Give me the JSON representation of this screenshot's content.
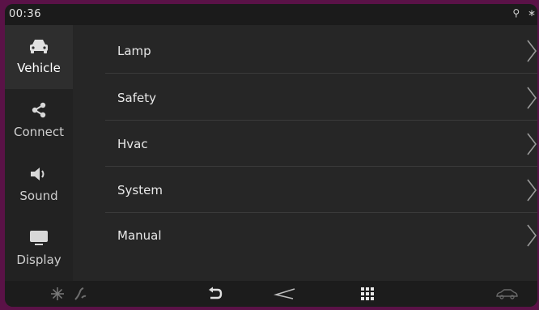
{
  "status": {
    "time": "00:36",
    "icons": [
      "usb-icon",
      "bluetooth-icon"
    ]
  },
  "sidebar": {
    "items": [
      {
        "label": "Vehicle",
        "icon": "car-icon",
        "active": true
      },
      {
        "label": "Connect",
        "icon": "share-icon",
        "active": false
      },
      {
        "label": "Sound",
        "icon": "speaker-icon",
        "active": false
      },
      {
        "label": "Display",
        "icon": "monitor-icon",
        "active": false
      }
    ]
  },
  "menu": {
    "items": [
      {
        "label": "Lamp"
      },
      {
        "label": "Safety"
      },
      {
        "label": "Hvac"
      },
      {
        "label": "System"
      },
      {
        "label": "Manual"
      }
    ]
  },
  "bottombar": {
    "icons": [
      "snowflake-icon",
      "seat-heat-icon",
      "back-icon",
      "brand-logo-icon",
      "apps-grid-icon",
      "car-status-icon"
    ]
  },
  "colors": {
    "frame": "#5a1247",
    "screen": "#242424",
    "text": "#e8e8e8"
  }
}
